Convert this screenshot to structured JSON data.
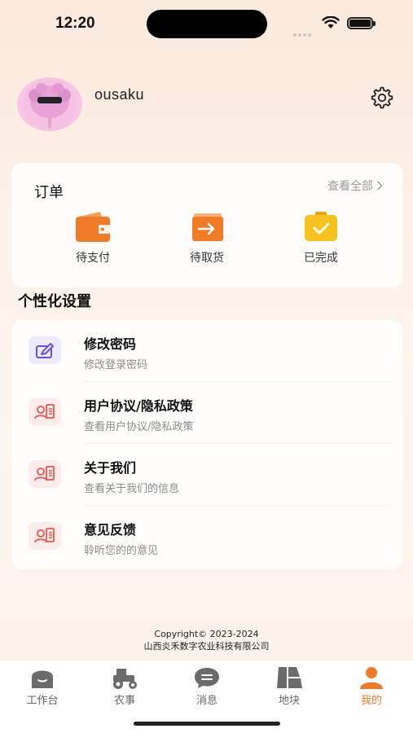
{
  "status_bar": {
    "time": "12:20"
  },
  "profile": {
    "username": "ousaku"
  },
  "orders": {
    "title": "订单",
    "view_all": "查看全部",
    "items": [
      {
        "label": "待支付",
        "icon": "wallet-icon"
      },
      {
        "label": "待取货",
        "icon": "pickup-icon"
      },
      {
        "label": "已完成",
        "icon": "completed-icon"
      }
    ]
  },
  "personal_settings": {
    "title": "个性化设置",
    "items": [
      {
        "title": "修改密码",
        "subtitle": "修改登录密码",
        "icon": "edit-password-icon"
      },
      {
        "title": "用户协议/隐私政策",
        "subtitle": "查看用户协议/隐私政策",
        "icon": "contact-card-icon"
      },
      {
        "title": "关于我们",
        "subtitle": "查看关于我们的信息",
        "icon": "contact-card-icon"
      },
      {
        "title": "意见反馈",
        "subtitle": "聆听您的的意见",
        "icon": "contact-card-icon"
      }
    ]
  },
  "footer": {
    "copyright": "Copyright© 2023-2024",
    "company": "山西炎禾数字农业科技有限公司"
  },
  "tabs": [
    {
      "label": "工作台",
      "icon": "workbench-icon",
      "active": false
    },
    {
      "label": "农事",
      "icon": "tractor-icon",
      "active": false
    },
    {
      "label": "消息",
      "icon": "message-icon",
      "active": false
    },
    {
      "label": "地块",
      "icon": "map-icon",
      "active": false
    },
    {
      "label": "我的",
      "icon": "profile-icon",
      "active": true
    }
  ],
  "colors": {
    "accent": "#f07a26",
    "lavender": "#ede9ff",
    "pink": "#fdeceb"
  }
}
